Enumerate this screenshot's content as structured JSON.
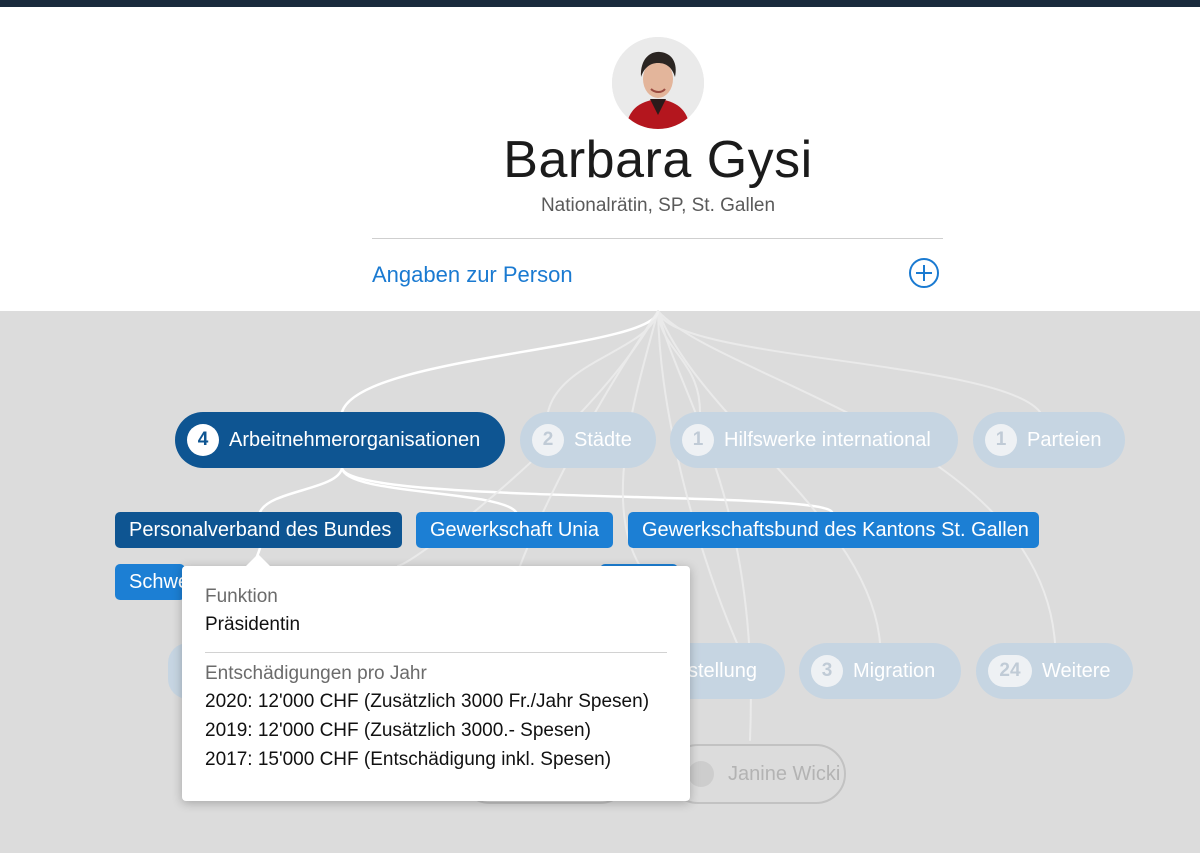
{
  "person": {
    "name": "Barbara Gysi",
    "subtitle": "Nationalrätin, SP, St. Gallen",
    "details_link": "Angaben zur Person"
  },
  "categories": [
    {
      "count": "4",
      "label": "Arbeitnehmerorganisationen",
      "active": true
    },
    {
      "count": "2",
      "label": "Städte"
    },
    {
      "count": "1",
      "label": "Hilfswerke international"
    },
    {
      "count": "1",
      "label": "Parteien"
    }
  ],
  "organizations": [
    {
      "label": "Personalverband des Bundes",
      "active": true
    },
    {
      "label": "Gewerkschaft Unia"
    },
    {
      "label": "Gewerkschaftsbund des Kantons St. Gallen"
    },
    {
      "label": "Schwe"
    }
  ],
  "lower_categories": [
    {
      "count": "",
      "label": "stellung"
    },
    {
      "count": "3",
      "label": "Migration"
    },
    {
      "count": "24",
      "label": "Weitere"
    }
  ],
  "contact": {
    "label": "Janine Wicki"
  },
  "tooltip": {
    "function_label": "Funktion",
    "function_value": "Präsidentin",
    "compensation_label": "Entschädigungen pro Jahr",
    "compensation": [
      "2020: 12'000 CHF (Zusätzlich 3000 Fr./Jahr Spesen)",
      "2019: 12'000 CHF (Zusätzlich 3000.- Spesen)",
      "2017: 15'000 CHF (Entschädigung inkl. Spesen)"
    ]
  },
  "colors": {
    "accent": "#1a7ad1",
    "active_pill": "#0e5592",
    "tag": "#1c7fd4",
    "inactive_pill": "#c6d5e2"
  }
}
